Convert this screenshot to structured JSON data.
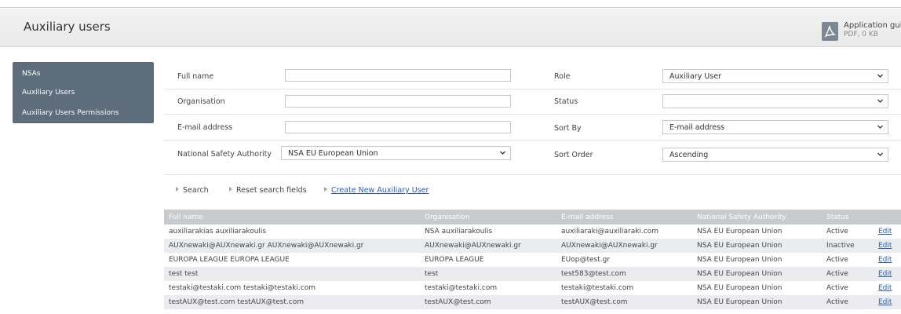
{
  "header": {
    "title": "Auxiliary users",
    "guide": {
      "title": "Application guide",
      "meta": "PDF, 0 KB",
      "icon": "pdf-icon"
    }
  },
  "sidebar": {
    "items": [
      {
        "label": "NSAs"
      },
      {
        "label": "Auxiliary Users"
      },
      {
        "label": "Auxiliary Users Permissions"
      }
    ]
  },
  "form": {
    "full_name_label": "Full name",
    "full_name_value": "",
    "organisation_label": "Organisation",
    "organisation_value": "",
    "email_label": "E-mail address",
    "email_value": "",
    "nsa_label": "National Safety Authority",
    "nsa_value": "NSA EU European Union",
    "role_label": "Role",
    "role_value": "Auxiliary User",
    "status_label": "Status",
    "status_value": "",
    "sort_by_label": "Sort By",
    "sort_by_value": "E-mail address",
    "sort_order_label": "Sort Order",
    "sort_order_value": "Ascending"
  },
  "actions": {
    "search": "Search",
    "reset": "Reset search fields",
    "create": "Create New Auxiliary User"
  },
  "table": {
    "columns": [
      "Full name",
      "Organisation",
      "E-mail address",
      "National Safety Authority",
      "Status"
    ],
    "rows": [
      {
        "name": "auxiliarakias auxiliarakoulis",
        "org": "NSA auxiliarakoulis",
        "email": "auxiliaraki@auxiliaraki.com",
        "nsa": "NSA EU European Union",
        "status": "Active",
        "action": "Edit"
      },
      {
        "name": "AUXnewaki@AUXnewaki.gr AUXnewaki@AUXnewaki.gr",
        "org": "AUXnewaki@AUXnewaki.gr",
        "email": "AUXnewaki@AUXnewaki.gr",
        "nsa": "NSA EU European Union",
        "status": "Inactive",
        "action": "Edit"
      },
      {
        "name": "EUROPA LEAGUE EUROPA LEAGUE",
        "org": "EUROPA LEAGUE",
        "email": "EUop@test.gr",
        "nsa": "NSA EU European Union",
        "status": "Active",
        "action": "Edit"
      },
      {
        "name": "test test",
        "org": "test",
        "email": "test583@test.com",
        "nsa": "NSA EU European Union",
        "status": "Active",
        "action": "Edit"
      },
      {
        "name": "testaki@testaki.com testaki@testaki.com",
        "org": "testaki@testaki.com",
        "email": "testaki@testaki.com",
        "nsa": "NSA EU European Union",
        "status": "Active",
        "action": "Edit"
      },
      {
        "name": "testAUX@test.com testAUX@test.com",
        "org": "testAUX@test.com",
        "email": "testAUX@test.com",
        "nsa": "NSA EU European Union",
        "status": "Active",
        "action": "Edit"
      }
    ]
  },
  "colors": {
    "sidebar_bg": "#5e6d7c",
    "table_header_bg": "#c8cbce",
    "row_alt_bg": "#eaecef",
    "link": "#2a5db0"
  }
}
